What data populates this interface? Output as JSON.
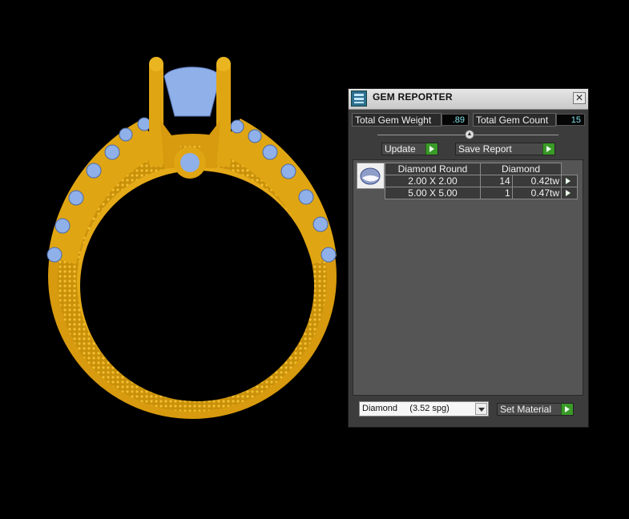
{
  "window": {
    "title": "GEM REPORTER",
    "close_glyph": "✕"
  },
  "stats": {
    "total_weight_label": "Total Gem Weight",
    "total_weight_value": ".89",
    "total_count_label": "Total Gem Count",
    "total_count_value": "15"
  },
  "toolbar": {
    "update_label": "Update",
    "save_report_label": "Save Report"
  },
  "table": {
    "headers": [
      "Diamond Round",
      "Diamond"
    ],
    "rows": [
      {
        "size": "2.00 X 2.00",
        "count": "14",
        "weight": "0.42tw"
      },
      {
        "size": "5.00 X 5.00",
        "count": "1",
        "weight": "0.47tw"
      }
    ]
  },
  "material": {
    "selected": "Diamond     (3.52 spg)",
    "set_label": "Set Material"
  },
  "colors": {
    "gold": "#e0a512",
    "gem": "#8fb0e8",
    "go_button": "#3a9a28"
  },
  "icons": {
    "app": "gem-reporter-icon",
    "thumb": "diamond-thumbnail-icon"
  }
}
